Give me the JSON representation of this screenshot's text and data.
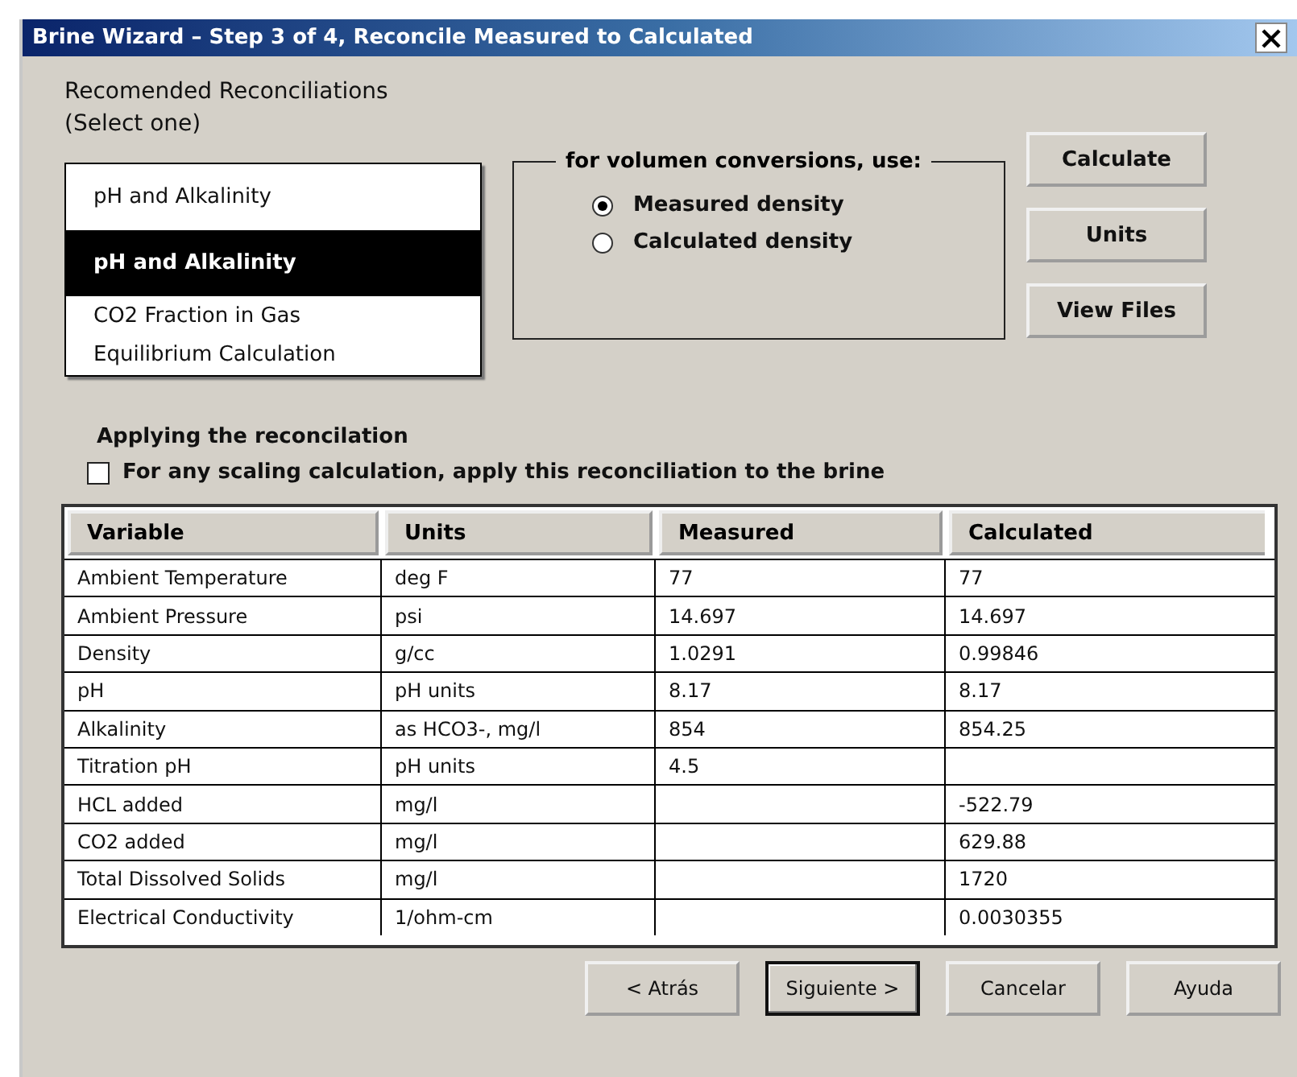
{
  "window": {
    "title": "Brine  Wizard – Step 3 of 4, Reconcile Measured to Calculated"
  },
  "reconciliations": {
    "heading": "Recomended Reconciliations",
    "subheading": "(Select one)",
    "items": [
      {
        "label": "pH and Alkalinity",
        "selected": false
      },
      {
        "label": "pH and Alkalinity",
        "selected": true
      },
      {
        "label": "CO2 Fraction in Gas",
        "selected": false
      },
      {
        "label": "Equilibrium Calculation",
        "selected": false
      }
    ]
  },
  "density_group": {
    "title": "for volumen conversions, use:",
    "options": [
      {
        "label": "Measured density",
        "selected": true
      },
      {
        "label": "Calculated density",
        "selected": false
      }
    ]
  },
  "side_buttons": [
    "Calculate",
    "Units",
    "View Files"
  ],
  "apply": {
    "heading": "Applying the reconcilation",
    "label": "For any scaling calculation, apply this reconciliation to the brine",
    "checked": false
  },
  "table": {
    "columns": [
      "Variable",
      "Units",
      "Measured",
      "Calculated"
    ],
    "rows": [
      [
        "Ambient Temperature",
        "deg F",
        "77",
        "77"
      ],
      [
        "Ambient Pressure",
        "psi",
        "14.697",
        "14.697"
      ],
      [
        "Density",
        "g/cc",
        "1.0291",
        "0.99846"
      ],
      [
        "pH",
        "pH units",
        "8.17",
        "8.17"
      ],
      [
        "Alkalinity",
        "as HCO3-, mg/l",
        "854",
        "854.25"
      ],
      [
        "Titration pH",
        "pH units",
        "4.5",
        ""
      ],
      [
        "HCL added",
        "mg/l",
        "",
        "-522.79"
      ],
      [
        "CO2 added",
        "mg/l",
        "",
        "629.88"
      ],
      [
        "Total Dissolved Solids",
        "mg/l",
        "",
        "1720"
      ],
      [
        "Electrical Conductivity",
        "1/ohm-cm",
        "",
        "0.0030355"
      ]
    ]
  },
  "footer_buttons": [
    {
      "label": "< Atrás",
      "default": false
    },
    {
      "label": "Siguiente >",
      "default": true
    },
    {
      "label": "Cancelar",
      "default": false
    },
    {
      "label": "Ayuda",
      "default": false
    }
  ]
}
